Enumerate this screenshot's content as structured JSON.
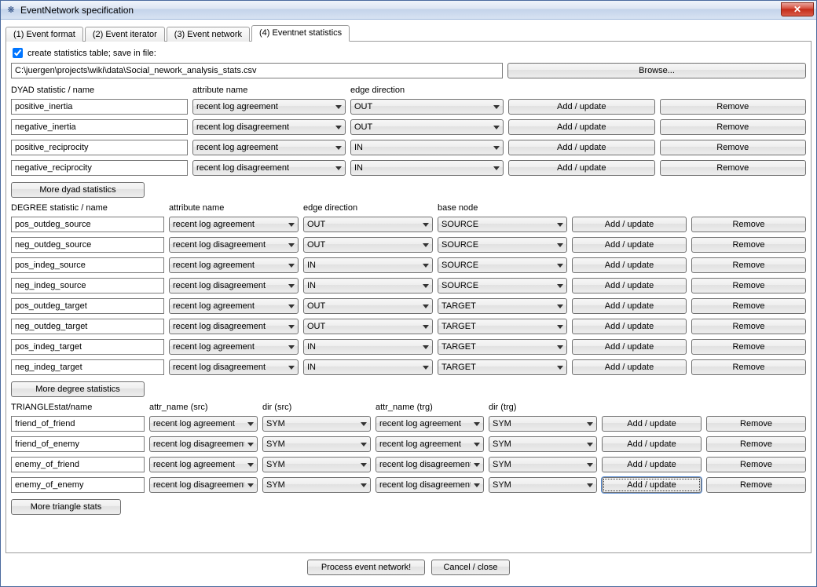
{
  "window": {
    "title": "EventNetwork specification",
    "close_glyph": "✕"
  },
  "tabs": [
    {
      "label": "(1) Event format"
    },
    {
      "label": "(2) Event iterator"
    },
    {
      "label": "(3) Event network"
    },
    {
      "label": "(4) Eventnet statistics"
    }
  ],
  "checkbox_label": "create statistics table; save in file:",
  "filepath": "C:\\juergen\\projects\\wiki\\data\\Social_nework_analysis_stats.csv",
  "browse_label": "Browse...",
  "dyad": {
    "headers": {
      "name": "DYAD statistic / name",
      "attr": "attribute name",
      "dir": "edge direction"
    },
    "rows": [
      {
        "name": "positive_inertia",
        "attr": "recent log agreement",
        "dir": "OUT"
      },
      {
        "name": "negative_inertia",
        "attr": "recent log disagreement",
        "dir": "OUT"
      },
      {
        "name": "positive_reciprocity",
        "attr": "recent log agreement",
        "dir": "IN"
      },
      {
        "name": "negative_reciprocity",
        "attr": "recent log disagreement",
        "dir": "IN"
      }
    ],
    "more_label": "More dyad statistics"
  },
  "degree": {
    "headers": {
      "name": "DEGREE statistic / name",
      "attr": "attribute name",
      "dir": "edge direction",
      "base": "base node"
    },
    "rows": [
      {
        "name": "pos_outdeg_source",
        "attr": "recent log agreement",
        "dir": "OUT",
        "base": "SOURCE"
      },
      {
        "name": "neg_outdeg_source",
        "attr": "recent log disagreement",
        "dir": "OUT",
        "base": "SOURCE"
      },
      {
        "name": "pos_indeg_source",
        "attr": "recent log agreement",
        "dir": "IN",
        "base": "SOURCE"
      },
      {
        "name": "neg_indeg_source",
        "attr": "recent log disagreement",
        "dir": "IN",
        "base": "SOURCE"
      },
      {
        "name": "pos_outdeg_target",
        "attr": "recent log agreement",
        "dir": "OUT",
        "base": "TARGET"
      },
      {
        "name": "neg_outdeg_target",
        "attr": "recent log disagreement",
        "dir": "OUT",
        "base": "TARGET"
      },
      {
        "name": "pos_indeg_target",
        "attr": "recent log agreement",
        "dir": "IN",
        "base": "TARGET"
      },
      {
        "name": "neg_indeg_target",
        "attr": "recent log disagreement",
        "dir": "IN",
        "base": "TARGET"
      }
    ],
    "more_label": "More degree statistics"
  },
  "triangle": {
    "headers": {
      "name": "TRIANGLEstat/name",
      "attr_src": "attr_name (src)",
      "dir_src": "dir (src)",
      "attr_trg": "attr_name (trg)",
      "dir_trg": "dir (trg)"
    },
    "rows": [
      {
        "name": "friend_of_friend",
        "attr_src": "recent log agreement",
        "dir_src": "SYM",
        "attr_trg": "recent log agreement",
        "dir_trg": "SYM"
      },
      {
        "name": "friend_of_enemy",
        "attr_src": "recent log disagreement",
        "dir_src": "SYM",
        "attr_trg": "recent log agreement",
        "dir_trg": "SYM"
      },
      {
        "name": "enemy_of_friend",
        "attr_src": "recent log agreement",
        "dir_src": "SYM",
        "attr_trg": "recent log disagreement",
        "dir_trg": "SYM"
      },
      {
        "name": "enemy_of_enemy",
        "attr_src": "recent log disagreement",
        "dir_src": "SYM",
        "attr_trg": "recent log disagreement",
        "dir_trg": "SYM"
      }
    ],
    "more_label": "More triangle stats"
  },
  "action_labels": {
    "add_update": "Add / update",
    "remove": "Remove"
  },
  "footer": {
    "process": "Process event network!",
    "cancel": "Cancel / close"
  }
}
